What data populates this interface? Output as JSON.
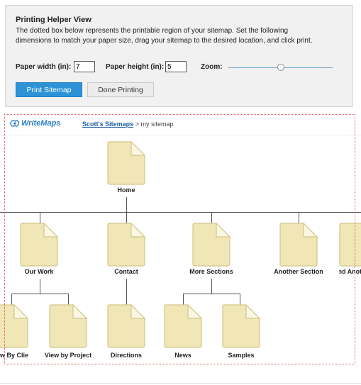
{
  "helper": {
    "title": "Printing Helper View",
    "description": "The dotted box below represents the printable region of your sitemap. Set the following dimensions to match your paper size, drag your sitemap to the desired location, and click print.",
    "paper_width_label": "Paper width (in):",
    "paper_width_value": "7",
    "paper_height_label": "Paper height (in):",
    "paper_height_value": "5",
    "zoom_label": "Zoom:",
    "zoom_level": 0.5,
    "print_button": "Print Sitemap",
    "done_button": "Done Printing",
    "accent_color": "#2d93d6"
  },
  "sitemap": {
    "logo_text": "WriteMaps",
    "breadcrumb_link": "Scott's Sitemaps",
    "breadcrumb_rest": "> my sitemap",
    "page_icon": "page-icon",
    "pages": {
      "home": "Home",
      "our_work": "Our Work",
      "contact": "Contact",
      "more_sections": "More Sections",
      "another_section": "Another Section",
      "and_another": "And Anot",
      "view_by_client": "w By Client",
      "view_by_project": "View by Project",
      "directions": "Directions",
      "news": "News",
      "samples": "Samples"
    }
  }
}
